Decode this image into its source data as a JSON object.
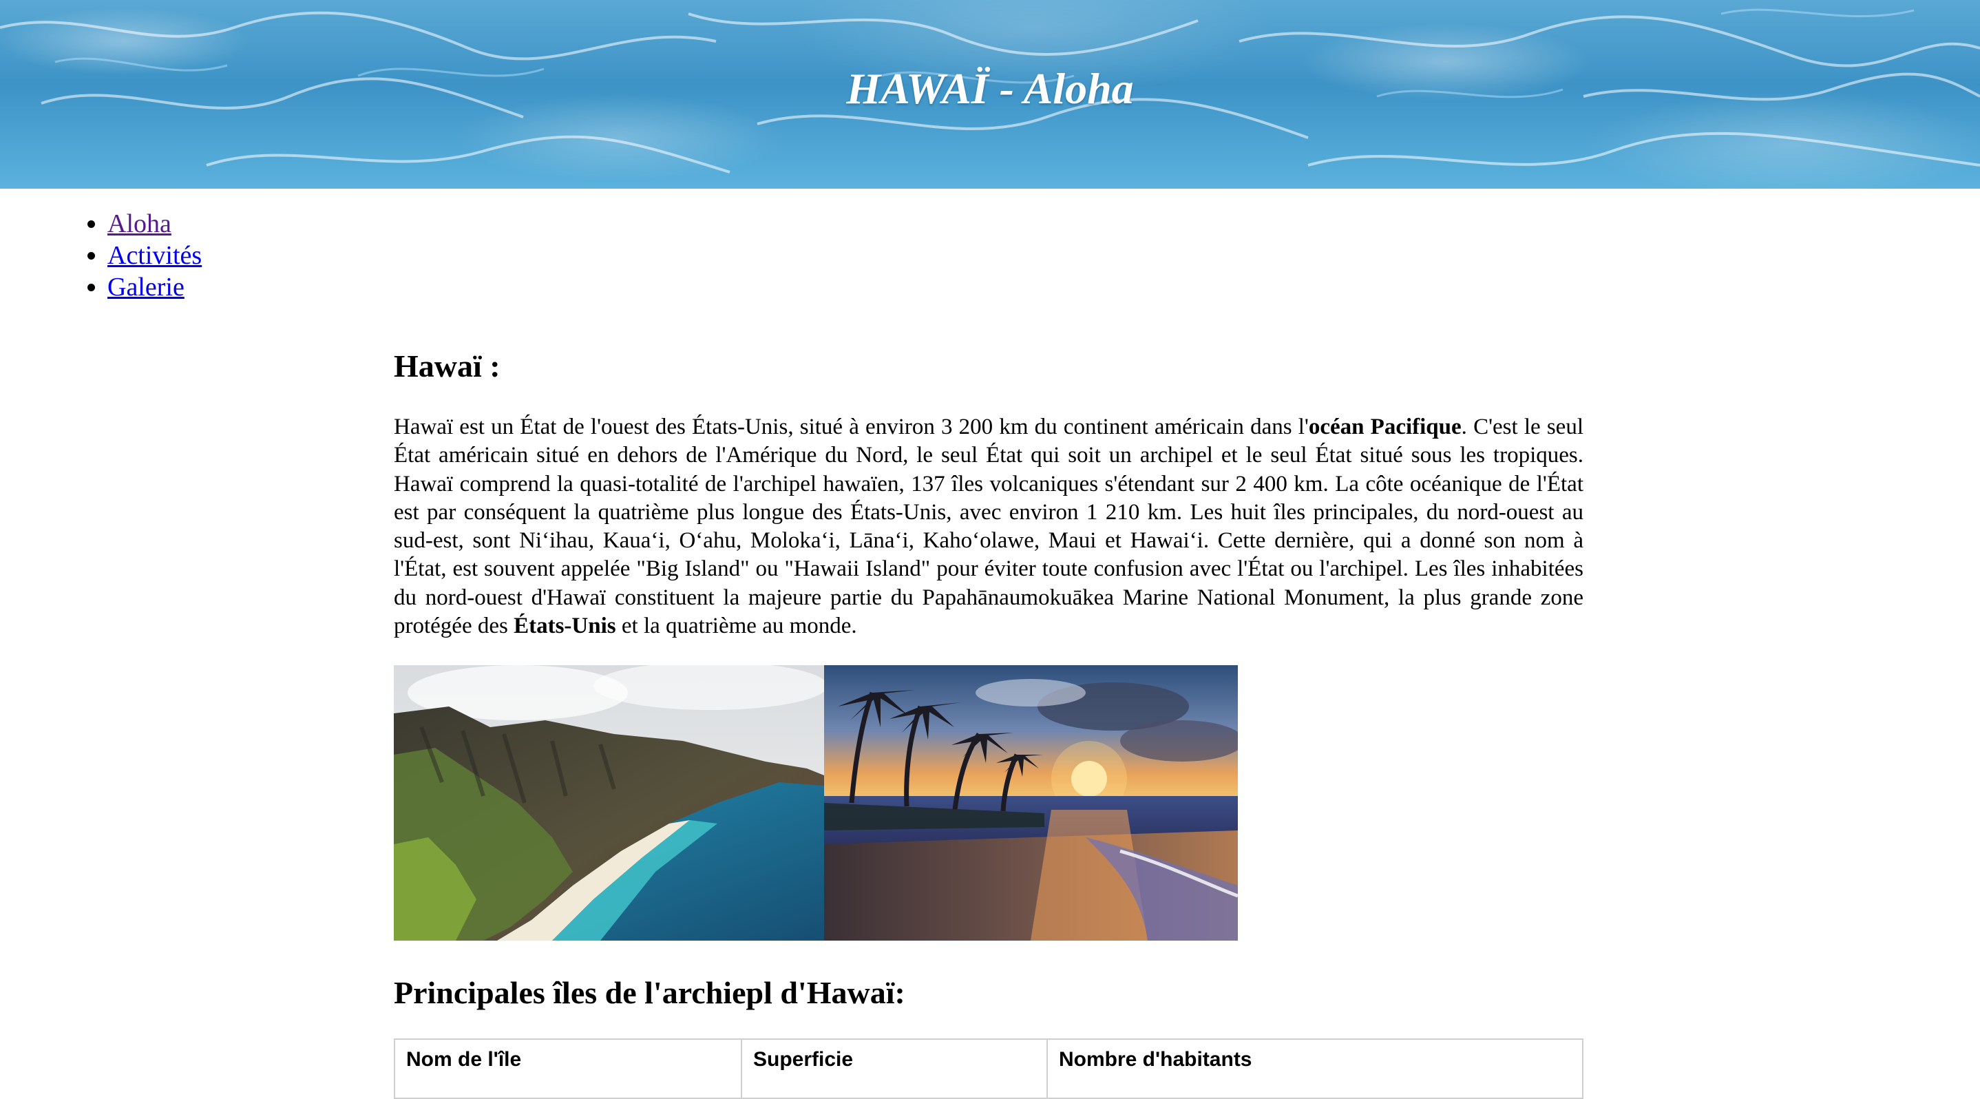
{
  "header": {
    "title": "HAWAÏ - Aloha"
  },
  "nav": {
    "items": [
      {
        "label": "Aloha",
        "visited": true
      },
      {
        "label": "Activités",
        "visited": false
      },
      {
        "label": "Galerie",
        "visited": false
      }
    ]
  },
  "main": {
    "heading": "Hawaï :",
    "paragraph": {
      "t1": "Hawaï est un État de l'ouest des États-Unis, situé à environ 3 200 km du continent américain dans l'",
      "b1": "océan Pacifique",
      "t2": ". C'est le seul État américain situé en dehors de l'Amérique du Nord, le seul État qui soit un archipel et le seul État situé sous les tropiques. Hawaï comprend la quasi-totalité de l'archipel hawaïen, 137 îles volcaniques s'étendant sur 2 400 km. La côte océanique de l'État est par conséquent la quatrième plus longue des États-Unis, avec environ 1 210 km. Les huit îles principales, du nord-ouest au sud-est, sont Niʻihau, Kauaʻi, Oʻahu, Molokaʻi, Lānaʻi, Kahoʻolawe, Maui et Hawaiʻi. Cette dernière, qui a donné son nom à l'État, est souvent appelée \"Big Island\" ou \"Hawaii Island\" pour éviter toute confusion avec l'État ou l'archipel. Les îles inhabitées du nord-ouest d'Hawaï constituent la majeure partie du Papahānaumokuākea Marine National Monument, la plus grande zone protégée des ",
      "b2": "États-Unis",
      "t3": " et la quatrième au monde."
    },
    "photos": [
      {
        "subject": "coastal cliffs and turquoise sea"
      },
      {
        "subject": "palm beach at sunset"
      }
    ],
    "islands_heading": "Principales îles de l'archiepl d'Hawaï:",
    "table_headers": [
      "Nom de l'île",
      "Superficie",
      "Nombre d'habitants"
    ]
  }
}
